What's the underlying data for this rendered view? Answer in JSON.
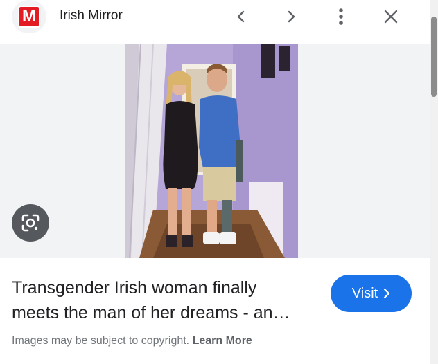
{
  "header": {
    "logo_letter": "M",
    "source_name": "Irish Mirror",
    "icons": [
      "chevron-left-icon",
      "chevron-right-icon",
      "more-vert-icon",
      "close-icon"
    ]
  },
  "image": {
    "lens_icon": "google-lens-icon"
  },
  "result": {
    "title_line1": "Transgender Irish woman finally",
    "title_line2": "meets the man of her dreams - an…",
    "visit_label": "Visit",
    "copyright_text": "Images may be subject to copyright.",
    "learn_more_label": "Learn More"
  },
  "colors": {
    "brand_red": "#e31b23",
    "visit_blue": "#1a73e8",
    "panel_bg": "#f1f3f4"
  }
}
